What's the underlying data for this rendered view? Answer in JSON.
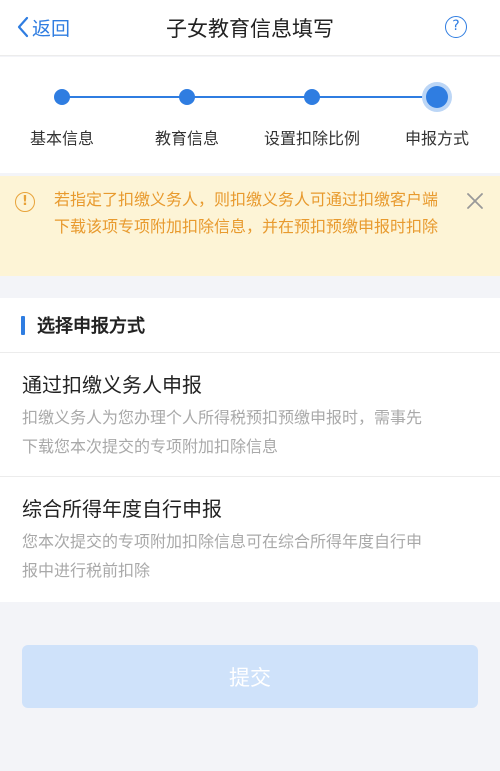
{
  "nav": {
    "back_label": "返回",
    "title": "子女教育信息填写",
    "help_symbol": "?"
  },
  "steps": [
    {
      "label": "基本信息",
      "active": false
    },
    {
      "label": "教育信息",
      "active": false
    },
    {
      "label": "设置扣除比例",
      "active": false
    },
    {
      "label": "申报方式",
      "active": true
    }
  ],
  "notice": {
    "icon_symbol": "!",
    "text": "若指定了扣缴义务人，则扣缴义务人可通过扣缴客户端下载该项专项附加扣除信息，并在预扣预缴申报时扣除"
  },
  "section": {
    "title": "选择申报方式"
  },
  "options": [
    {
      "title": "通过扣缴义务人申报",
      "desc": "扣缴义务人为您办理个人所得税预扣预缴申报时，需事先下载您本次提交的专项附加扣除信息"
    },
    {
      "title": "综合所得年度自行申报",
      "desc": "您本次提交的专项附加扣除信息可在综合所得年度自行申报中进行税前扣除"
    }
  ],
  "submit_label": "提交",
  "colors": {
    "accent": "#2f7de1",
    "notice_bg": "#fdf4d6",
    "notice_text": "#e89a2e",
    "submit_disabled": "#cfe2fa"
  }
}
